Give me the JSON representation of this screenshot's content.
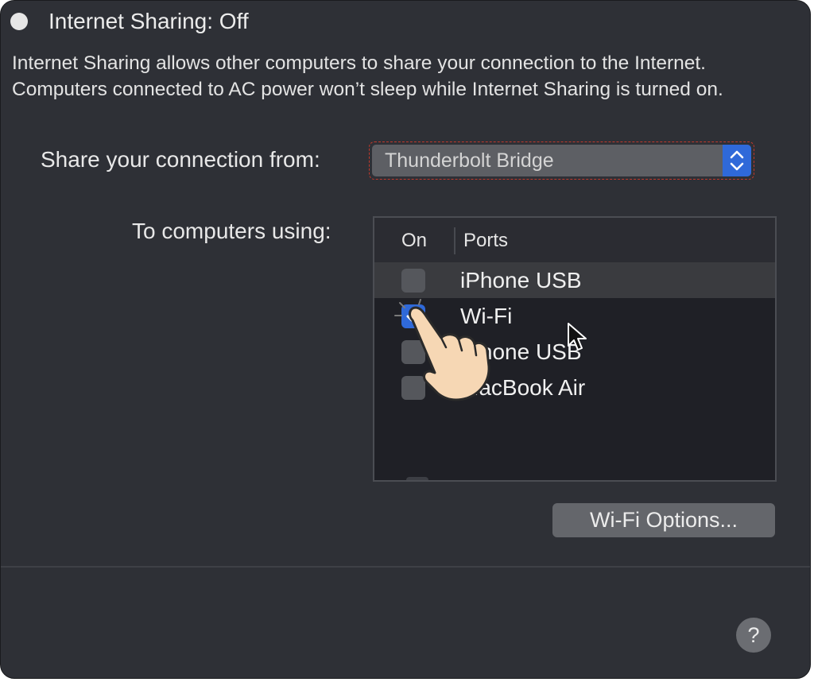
{
  "status": {
    "title": "Internet Sharing: Off"
  },
  "description": "Internet Sharing allows other computers to share your connection to the Internet. Computers connected to AC power won’t sleep while Internet Sharing is turned on.",
  "share_from": {
    "label": "Share your connection from:",
    "value": "Thunderbolt Bridge"
  },
  "to_computers": {
    "label": "To computers using:",
    "columns": {
      "on": "On",
      "ports": "Ports"
    },
    "rows": [
      {
        "label": "iPhone USB",
        "checked": false,
        "selected": true
      },
      {
        "label": "Wi-Fi",
        "checked": true,
        "selected": false
      },
      {
        "label": "iPhone USB",
        "checked": false,
        "selected": false
      },
      {
        "label": "MacBook Air",
        "checked": false,
        "selected": false
      }
    ]
  },
  "wifi_options_label": "Wi-Fi Options...",
  "help_label": "?",
  "colors": {
    "window_bg": "#2e3036",
    "accent": "#2f69d9",
    "table_bg": "#1f2026"
  }
}
